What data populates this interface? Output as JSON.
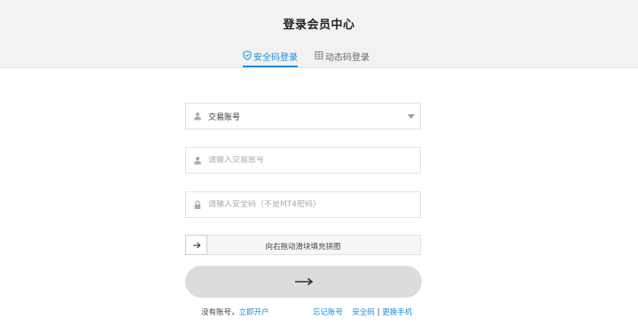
{
  "header": {
    "title": "登录会员中心"
  },
  "tabs": [
    {
      "label": "安全码登录",
      "icon": "shield-check-icon",
      "active": true
    },
    {
      "label": "动态码登录",
      "icon": "grid-icon",
      "active": false
    }
  ],
  "form": {
    "account_type": {
      "value": "交易账号",
      "icon": "user-icon"
    },
    "account_input": {
      "placeholder": "请输入交易账号",
      "icon": "user-icon"
    },
    "security_input": {
      "placeholder": "请输入安全码（不是MT4密码）",
      "icon": "lock-icon"
    },
    "slider": {
      "label": "向右拖动滑块填充拼图",
      "icon": "arrow-right-icon"
    },
    "submit": {
      "icon": "long-arrow-right-icon"
    }
  },
  "footer": {
    "no_account_text": "没有账号，",
    "register_link": "立即开户",
    "forgot_account": "忘记账号",
    "forgot_security": "安全码",
    "separator": "|",
    "change_phone": "更换手机"
  },
  "colors": {
    "accent": "#1a8fd9",
    "header_bg": "#f2f2f2",
    "submit_bg": "#dcdcdc"
  }
}
